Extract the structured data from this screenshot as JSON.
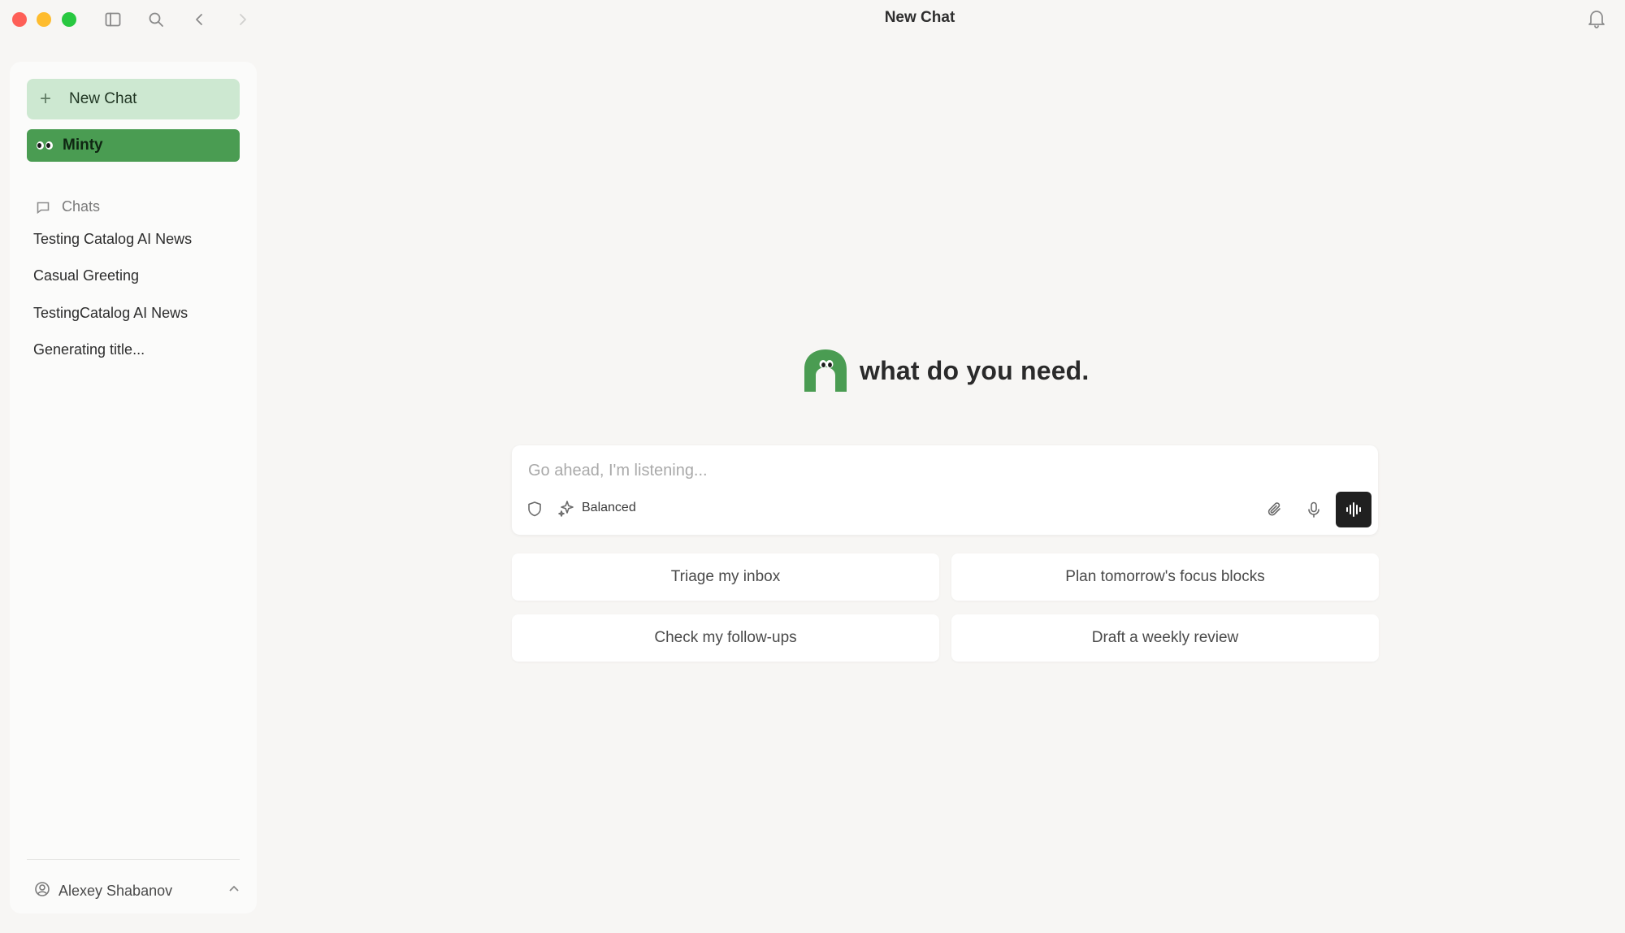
{
  "window": {
    "title": "New Chat"
  },
  "sidebar": {
    "new_chat_label": "New Chat",
    "assistant_label": "Minty",
    "chats_header": "Chats",
    "chats": [
      {
        "title": "Testing Catalog AI News"
      },
      {
        "title": "Casual Greeting"
      },
      {
        "title": "TestingCatalog AI News"
      },
      {
        "title": "Generating title..."
      }
    ],
    "user_name": "Alexey Shabanov"
  },
  "main": {
    "greeting": "what do you need.",
    "composer": {
      "placeholder": "Go ahead, I'm listening...",
      "mode_label": "Balanced"
    },
    "suggestions": [
      "Triage my inbox",
      "Plan tomorrow's focus blocks",
      "Check my follow-ups",
      "Draft a weekly review"
    ]
  },
  "colors": {
    "accent_green": "#4a9c52",
    "new_chat_bg": "#cde8d1",
    "voice_button_bg": "#202020",
    "background": "#f7f6f4"
  },
  "icons": [
    "close-window",
    "minimize-window",
    "maximize-window",
    "sidebar-toggle-icon",
    "search-icon",
    "back-arrow-icon",
    "forward-arrow-icon",
    "bell-icon",
    "plus-icon",
    "minty-eyes-icon",
    "chat-bubble-icon",
    "user-circle-icon",
    "chevron-up-icon",
    "shield-icon",
    "sparkles-icon",
    "paperclip-icon",
    "microphone-icon",
    "voice-waveform-icon"
  ]
}
